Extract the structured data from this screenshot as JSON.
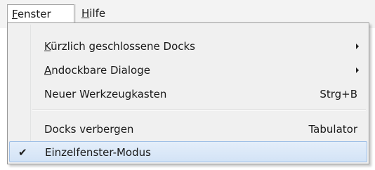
{
  "menubar": {
    "items": [
      {
        "prefix": "",
        "underline": "F",
        "rest": "enster"
      },
      {
        "prefix": "",
        "underline": "H",
        "rest": "ilfe"
      }
    ]
  },
  "dropdown": {
    "items": [
      {
        "underline": "K",
        "rest": "ürzlich geschlossene Docks",
        "shortcut": "",
        "submenu": true
      },
      {
        "underline": "A",
        "rest": "ndockbare Dialoge",
        "shortcut": "",
        "submenu": true
      },
      {
        "underline": "",
        "rest": "Neuer Werkzeugkasten",
        "shortcut": "Strg+B",
        "submenu": false
      },
      {
        "underline": "",
        "rest": "Docks verbergen",
        "shortcut": "Tabulator",
        "submenu": false
      },
      {
        "underline": "",
        "rest": "Einzelfenster-Modus",
        "shortcut": "",
        "submenu": false,
        "checked": true
      }
    ],
    "check_glyph": "✔"
  },
  "colors": {
    "selected_bg": "#d9e7f8",
    "selected_border": "#9fbfe6",
    "menu_bg": "#f0f0f0",
    "menubar_bg": "#f3f3f3"
  }
}
